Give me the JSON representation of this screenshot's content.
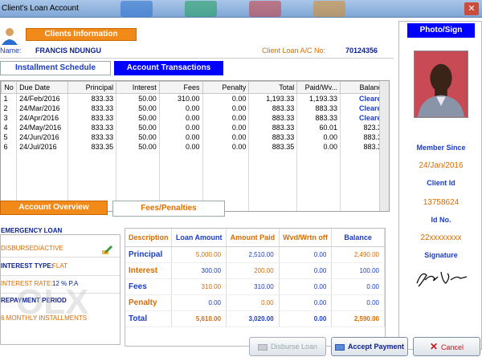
{
  "window": {
    "title": "Client's Loan Account",
    "close_glyph": "✕"
  },
  "client": {
    "section_label": "Clients Information",
    "name_label": "Name:",
    "name_value": "FRANCIS NDUNGU",
    "ac_label": "Client Loan A/C No:",
    "ac_value": "70124356"
  },
  "tabs": {
    "installment": "Installment Schedule",
    "transactions": "Account Transactions"
  },
  "schedule": {
    "headers": [
      "No",
      "Due Date",
      "Principal",
      "Interest",
      "Fees",
      "Penalty",
      "Total",
      "Paid/Wv...",
      "Balance"
    ],
    "rows": [
      [
        "1",
        "24/Feb/2016",
        "833.33",
        "50.00",
        "310.00",
        "0.00",
        "1,193.33",
        "1,193.33",
        "Cleared"
      ],
      [
        "2",
        "24/Mar/2016",
        "833.33",
        "50.00",
        "0.00",
        "0.00",
        "883.33",
        "883.33",
        "Cleared"
      ],
      [
        "3",
        "24/Apr/2016",
        "833.33",
        "50.00",
        "0.00",
        "0.00",
        "883.33",
        "883.33",
        "Cleared"
      ],
      [
        "4",
        "24/May/2016",
        "833.33",
        "50.00",
        "0.00",
        "0.00",
        "883.33",
        "60.01",
        "823.32"
      ],
      [
        "5",
        "24/Jun/2016",
        "833.33",
        "50.00",
        "0.00",
        "0.00",
        "883.33",
        "0.00",
        "883.33"
      ],
      [
        "6",
        "24/Jul/2016",
        "833.35",
        "50.00",
        "0.00",
        "0.00",
        "883.35",
        "0.00",
        "883.35"
      ]
    ]
  },
  "lower_tabs": {
    "overview": "Account Overview",
    "fees": "Fees/Penalties"
  },
  "overview": {
    "loan_type": "EMERGENCY LOAN",
    "status": "DISBURSED/ACTIVE",
    "interest_type_label": "INTEREST TYPE:",
    "interest_type_value": "FLAT",
    "interest_rate_label": "INTEREST RATE:",
    "interest_rate_value": "12 % P.A",
    "repayment_label": "REPAYMENT PERIOD",
    "repayment_value": "6 MONTHLY INSTALLMENTS"
  },
  "fees_table": {
    "headers": [
      "Description",
      "Loan Amount",
      "Amount Paid",
      "Wvd/Wrtn off",
      "Balance"
    ],
    "rows": [
      [
        "Principal",
        "5,000.00",
        "2,510.00",
        "0.00",
        "2,490.00"
      ],
      [
        "Interest",
        "300.00",
        "200.00",
        "0.00",
        "100.00"
      ],
      [
        "Fees",
        "310.00",
        "310.00",
        "0.00",
        "0.00"
      ],
      [
        "Penalty",
        "0.00",
        "0.00",
        "0.00",
        "0.00"
      ],
      [
        "Total",
        "5,610.00",
        "3,020.00",
        "0.00",
        "2,590.00"
      ]
    ]
  },
  "photo_panel": {
    "title": "Photo/Sign",
    "member_since_label": "Member Since",
    "member_since_value": "24/Jan/2016",
    "client_id_label": "Client Id",
    "client_id_value": "13758624",
    "id_no_label": "Id No.",
    "id_no_value": "22xxxxxxxx",
    "signature_label": "Signature"
  },
  "buttons": {
    "disburse": "Disburse Loan",
    "accept": "Accept Payment",
    "cancel": "Cancel"
  },
  "colors": {
    "accent_orange": "#f28a1a",
    "accent_blue": "#0000ff",
    "label_blue": "#1a3cc8"
  }
}
